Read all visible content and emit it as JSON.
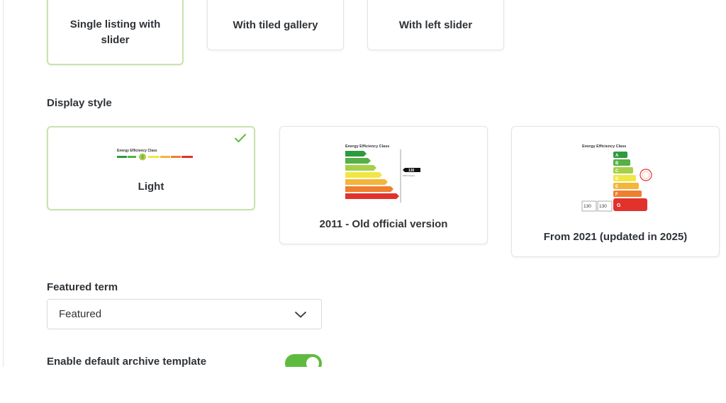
{
  "layout_options": {
    "items": [
      {
        "label": "Single listing with slider",
        "selected": true
      },
      {
        "label": "With tiled gallery",
        "selected": false
      },
      {
        "label": "With left slider",
        "selected": false
      }
    ]
  },
  "display_style": {
    "title": "Display style",
    "options": [
      {
        "label": "Light",
        "selected": true,
        "thumb_title": "Energy Efficiency Class",
        "active_class": "C"
      },
      {
        "label": "2011 - Old official version",
        "selected": false,
        "thumb_title": "Energy Efficiency Class",
        "value": "130",
        "unit": "kWh/m²/year"
      },
      {
        "label": "From 2021 (updated in 2025)",
        "selected": false,
        "thumb_title": "Energy Efficiency Class",
        "value_a": "130",
        "value_b": "130",
        "active_class": "G"
      }
    ],
    "classes": [
      "A",
      "B",
      "C",
      "D",
      "E",
      "F",
      "G"
    ],
    "class_colors": [
      "#2e9a3e",
      "#55b046",
      "#a6d04a",
      "#f0e646",
      "#f4b53b",
      "#ee7f2f",
      "#e2322c"
    ]
  },
  "featured_term": {
    "title": "Featured term",
    "value": "Featured",
    "icon": "chevron-down-icon"
  },
  "archive_template": {
    "title": "Enable default archive template",
    "enabled": true
  },
  "colors": {
    "accent": "#5fbb3f",
    "selected_border": "#c9e3ad"
  }
}
